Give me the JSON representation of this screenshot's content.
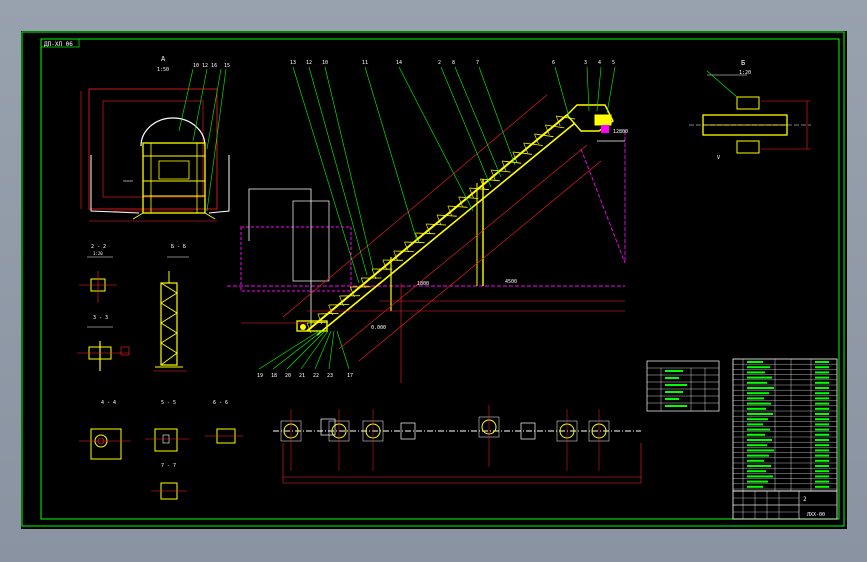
{
  "drawing": {
    "sheet_tag": "ДП-ХЛ 06",
    "sheet_number": "2",
    "drawing_code": "ЛХХ-00"
  },
  "views": {
    "end_view_label": "А",
    "end_view_scale": "1:50",
    "top_right_label": "Б",
    "top_right_scale": "1:20"
  },
  "dims": {
    "elev_top": "12800",
    "elev_mid": "4500",
    "elev_low": "1800",
    "elev_base": "0.000"
  },
  "callouts_top": [
    "13",
    "12",
    "10",
    "11",
    "14",
    "2",
    "8",
    "7",
    "6",
    "3",
    "4",
    "5"
  ],
  "callouts_bottom": [
    "19",
    "18",
    "20",
    "21",
    "22",
    "23",
    "17"
  ],
  "colors": {
    "frame": "#00ff00",
    "structure": "#ffff00",
    "dimension": "#ff2020",
    "center": "#ff00ff",
    "leader": "#00ff00",
    "text": "#ffffff",
    "background": "#000000",
    "viewport_bg": "#8f98a6"
  }
}
